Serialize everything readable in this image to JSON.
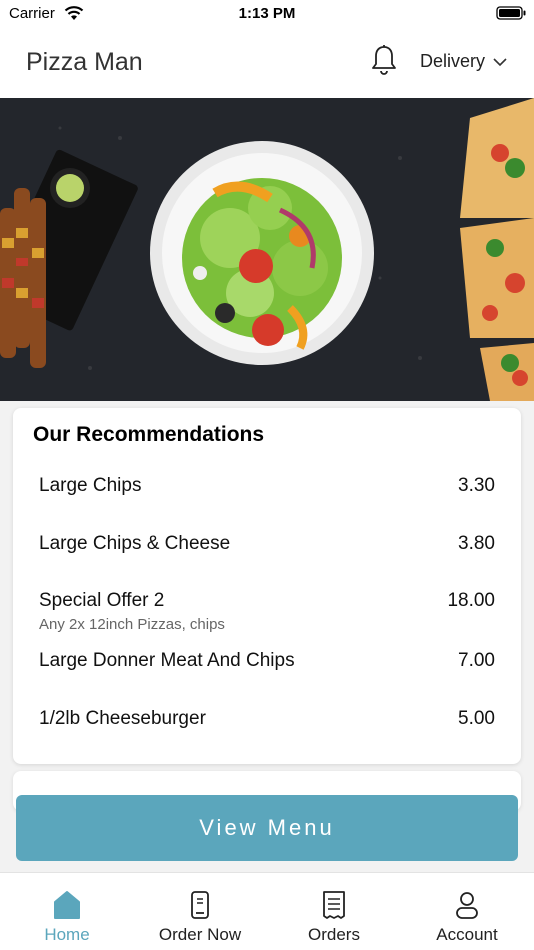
{
  "status_bar": {
    "carrier": "Carrier",
    "time": "1:13 PM"
  },
  "header": {
    "title": "Pizza Man",
    "delivery_label": "Delivery"
  },
  "recommendations": {
    "title": "Our Recommendations",
    "items": [
      {
        "name": "Large Chips",
        "price": "3.30",
        "description": ""
      },
      {
        "name": "Large Chips & Cheese",
        "price": "3.80",
        "description": ""
      },
      {
        "name": "Special Offer 2",
        "price": "18.00",
        "description": "Any 2x 12inch Pizzas, chips"
      },
      {
        "name": "Large Donner Meat And Chips",
        "price": "7.00",
        "description": ""
      },
      {
        "name": "1/2lb Cheeseburger",
        "price": "5.00",
        "description": ""
      }
    ]
  },
  "view_menu_label": "View Menu",
  "tabs": [
    {
      "label": "Home",
      "icon": "home-icon",
      "active": true
    },
    {
      "label": "Order Now",
      "icon": "phone-icon",
      "active": false
    },
    {
      "label": "Orders",
      "icon": "receipt-icon",
      "active": false
    },
    {
      "label": "Account",
      "icon": "user-icon",
      "active": false
    }
  ],
  "colors": {
    "accent": "#5ba6bc",
    "hero_bg": "#1f2228"
  }
}
